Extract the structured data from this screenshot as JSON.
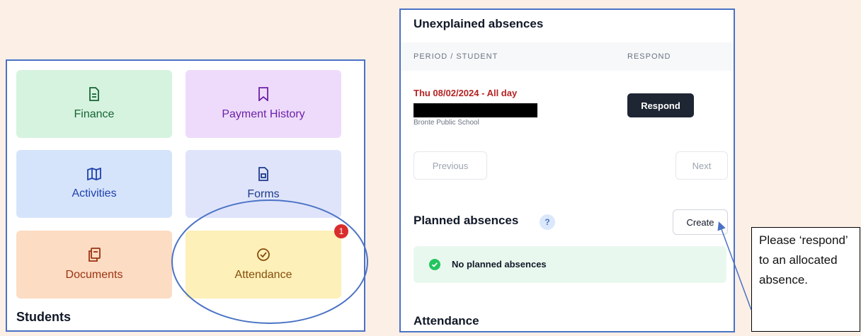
{
  "left_panel": {
    "tiles": [
      {
        "label": "Finance",
        "icon": "document-icon"
      },
      {
        "label": "Payment History",
        "icon": "bookmark-icon"
      },
      {
        "label": "Activities",
        "icon": "map-icon"
      },
      {
        "label": "Forms",
        "icon": "form-icon"
      },
      {
        "label": "Documents",
        "icon": "clipboard-icon"
      },
      {
        "label": "Attendance",
        "icon": "check-circle-icon"
      }
    ],
    "attendance_badge": "1",
    "students_heading": "Students"
  },
  "right_panel": {
    "title": "Unexplained absences",
    "table_headers": {
      "period": "PERIOD / STUDENT",
      "respond": "RESPOND"
    },
    "row": {
      "date": "Thu 08/02/2024 - All day",
      "school": "Bronte Public School",
      "respond_label": "Respond"
    },
    "pagination": {
      "previous": "Previous",
      "next": "Next"
    },
    "planned": {
      "title": "Planned absences",
      "help": "?",
      "create_label": "Create",
      "empty_message": "No planned absences"
    },
    "attendance_heading": "Attendance"
  },
  "callout": {
    "text": "Please ‘respond’ to an allocated absence."
  },
  "colors": {
    "accent": "#4a72c4",
    "badge": "#d92d2d",
    "respond_button": "#1e2533",
    "date_text": "#b42323",
    "success": "#22c55e"
  }
}
